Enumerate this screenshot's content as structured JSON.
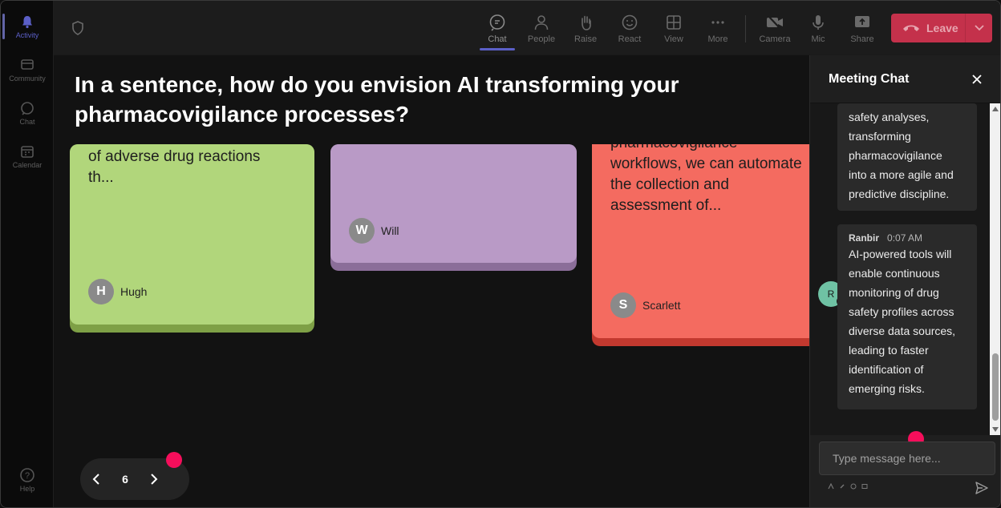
{
  "rail": {
    "items": [
      {
        "label": "Activity",
        "icon": "bell-icon",
        "active": true
      },
      {
        "label": "Community",
        "icon": "community-icon"
      },
      {
        "label": "Chat",
        "icon": "chat-icon"
      },
      {
        "label": "Calendar",
        "icon": "calendar-icon"
      },
      {
        "label": "Help",
        "icon": "help-icon"
      }
    ]
  },
  "toolbar": {
    "buttons": [
      {
        "label": "Chat",
        "icon": "chat-icon",
        "active": true
      },
      {
        "label": "People",
        "icon": "people-icon"
      },
      {
        "label": "Raise",
        "icon": "hand-icon"
      },
      {
        "label": "React",
        "icon": "smile-icon"
      },
      {
        "label": "View",
        "icon": "grid-icon"
      },
      {
        "label": "More",
        "icon": "more-icon"
      },
      {
        "label": "Camera",
        "icon": "camera-off-icon"
      },
      {
        "label": "Mic",
        "icon": "mic-icon"
      },
      {
        "label": "Share",
        "icon": "share-icon"
      }
    ],
    "leave_label": "Leave"
  },
  "main": {
    "question": "In a sentence, how do you envision AI transforming your pharmacovigilance processes?",
    "cards": [
      {
        "text_lines": [
          "of adverse drug reactions",
          "th..."
        ],
        "author": "Hugh",
        "initial": "H",
        "color": "#b1d67b",
        "shadow": "#7ea046"
      },
      {
        "text_lines": [],
        "author": "Will",
        "initial": "W",
        "color": "#b99ac6",
        "shadow": "#8b6e99"
      },
      {
        "text_lines": [
          "pharmacovigilance",
          "workflows, we can automate",
          "the collection and",
          "assessment of..."
        ],
        "author": "Scarlett",
        "initial": "S",
        "color": "#f46b60",
        "shadow": "#c2392f"
      }
    ],
    "pager": {
      "page": "6"
    }
  },
  "chat": {
    "title": "Meeting Chat",
    "messages": [
      {
        "lines": [
          "safety analyses,",
          "transforming",
          "pharmacovigilance",
          "into a more agile and",
          "predictive discipline."
        ]
      },
      {
        "author": "Ranbir",
        "time": "0:07 AM",
        "initial": "R",
        "lines": [
          "AI-powered tools will",
          "enable continuous",
          "monitoring of drug",
          "safety profiles across",
          "diverse data sources,",
          "leading to faster",
          "identification of",
          "emerging risks."
        ]
      }
    ],
    "input_placeholder": "Type message here..."
  },
  "colors": {
    "accent": "#5b5fc7",
    "leave": "#c4314b",
    "dot": "#f50e5b"
  }
}
